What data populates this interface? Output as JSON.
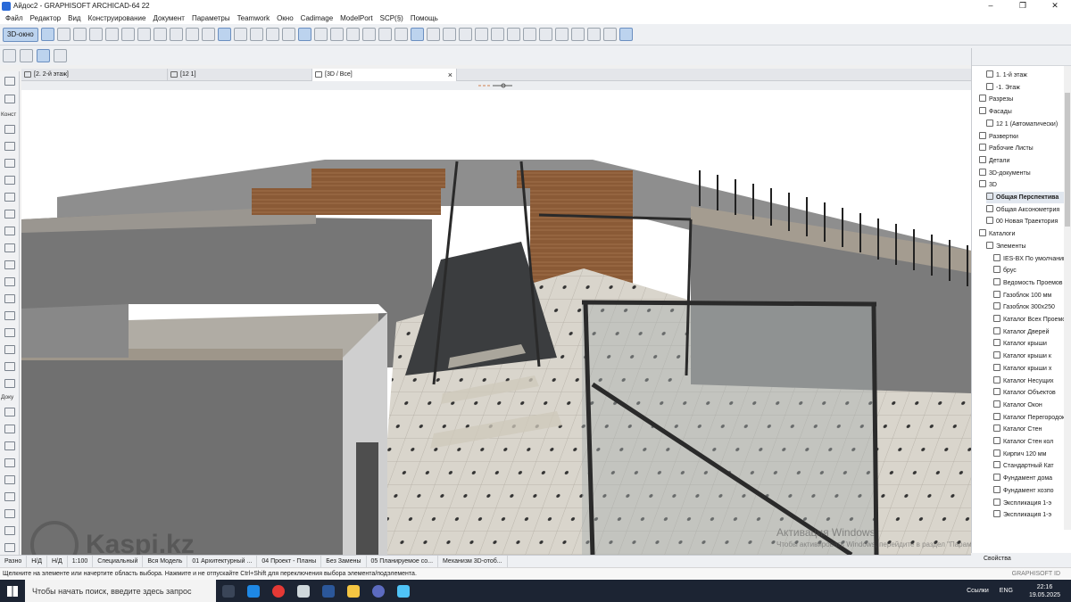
{
  "window": {
    "title": "Айдос2 - GRAPHISOFT ARCHICAD-64 22"
  },
  "menu": [
    "Файл",
    "Редактор",
    "Вид",
    "Конструирование",
    "Документ",
    "Параметры",
    "Teamwork",
    "Окно",
    "Cadimage",
    "ModelPort",
    "SCP(§)",
    "Помощь"
  ],
  "toolbar": {
    "view_3d_label": "3D-окно"
  },
  "tabs": [
    {
      "label": "[2. 2-й этаж]",
      "active": false
    },
    {
      "label": "[12 1]",
      "active": false
    },
    {
      "label": "[3D / Все]",
      "active": true
    }
  ],
  "left_sections": [
    "Конст",
    "Доку"
  ],
  "navigator": {
    "items": [
      {
        "label": "1. 1-й этаж",
        "level": 2,
        "selected": false
      },
      {
        "label": "-1. Этаж",
        "level": 2,
        "selected": false
      },
      {
        "label": "Разрезы",
        "level": 1,
        "selected": false
      },
      {
        "label": "Фасады",
        "level": 1,
        "selected": false
      },
      {
        "label": "12 1 (Автоматически)",
        "level": 2,
        "selected": false
      },
      {
        "label": "Развертки",
        "level": 1,
        "selected": false
      },
      {
        "label": "Рабочие Листы",
        "level": 1,
        "selected": false
      },
      {
        "label": "Детали",
        "level": 1,
        "selected": false
      },
      {
        "label": "3D-документы",
        "level": 1,
        "selected": false
      },
      {
        "label": "3D",
        "level": 1,
        "selected": false
      },
      {
        "label": "Общая Перспектива",
        "level": 2,
        "selected": true
      },
      {
        "label": "Общая Аксонометрия",
        "level": 2,
        "selected": false
      },
      {
        "label": "00 Новая Траектория",
        "level": 2,
        "selected": false
      },
      {
        "label": "Каталоги",
        "level": 1,
        "selected": false
      },
      {
        "label": "Элементы",
        "level": 2,
        "selected": false
      },
      {
        "label": "IES-BX По умолчанию",
        "level": 3,
        "selected": false
      },
      {
        "label": "брус",
        "level": 3,
        "selected": false
      },
      {
        "label": "Ведомость Проемов",
        "level": 3,
        "selected": false
      },
      {
        "label": "Газоблок 100 мм",
        "level": 3,
        "selected": false
      },
      {
        "label": "Газоблок 300х250",
        "level": 3,
        "selected": false
      },
      {
        "label": "Каталог Всех Проемов",
        "level": 3,
        "selected": false
      },
      {
        "label": "Каталог Дверей",
        "level": 3,
        "selected": false
      },
      {
        "label": "Каталог крыши",
        "level": 3,
        "selected": false
      },
      {
        "label": "Каталог крыши к",
        "level": 3,
        "selected": false
      },
      {
        "label": "Каталог крыши х",
        "level": 3,
        "selected": false
      },
      {
        "label": "Каталог Несущих",
        "level": 3,
        "selected": false
      },
      {
        "label": "Каталог Объектов",
        "level": 3,
        "selected": false
      },
      {
        "label": "Каталог Окон",
        "level": 3,
        "selected": false
      },
      {
        "label": "Каталог Перегородок",
        "level": 3,
        "selected": false
      },
      {
        "label": "Каталог Стен",
        "level": 3,
        "selected": false
      },
      {
        "label": "Каталог Стен кол",
        "level": 3,
        "selected": false
      },
      {
        "label": "Кирпич 120 мм",
        "level": 3,
        "selected": false
      },
      {
        "label": "Стандартный Кат",
        "level": 3,
        "selected": false
      },
      {
        "label": "Фундамент дома",
        "level": 3,
        "selected": false
      },
      {
        "label": "Фундамент хозпо",
        "level": 3,
        "selected": false
      },
      {
        "label": "Экспликация 1-э",
        "level": 3,
        "selected": false
      },
      {
        "label": "Экспликация 1-э",
        "level": 3,
        "selected": false
      }
    ],
    "properties_label": "Свойства",
    "brand": "GRAPHISOFT ID"
  },
  "status": {
    "section": "Разно",
    "na1": "Н/Д",
    "na2": "Н/Д",
    "scale": "1:100",
    "mode": "Специальный",
    "model": "Вся Модель",
    "arch": "01 Архитектурный ...",
    "project": "04 Проект - Планы",
    "replace": "Без Замены",
    "plan": "05 Планируемое со...",
    "engine": "Механизм 3D-отоб..."
  },
  "hint": "Щелкните на элементе или начертите область выбора. Нажмите и не отпускайте Ctrl+Shift для переключения выбора элемента/подэлемента.",
  "watermark": {
    "title": "Активация Windows",
    "subtitle": "Чтобы активировать Windows, перейдите в раздел \"Параметры\"."
  },
  "overlay_logo": "Kaspi.kz",
  "taskbar": {
    "search_placeholder": "Чтобы начать поиск, введите здесь запрос",
    "links": "Ссылки",
    "lang": "ENG",
    "time": "22:16",
    "date": "19.05.2025"
  }
}
